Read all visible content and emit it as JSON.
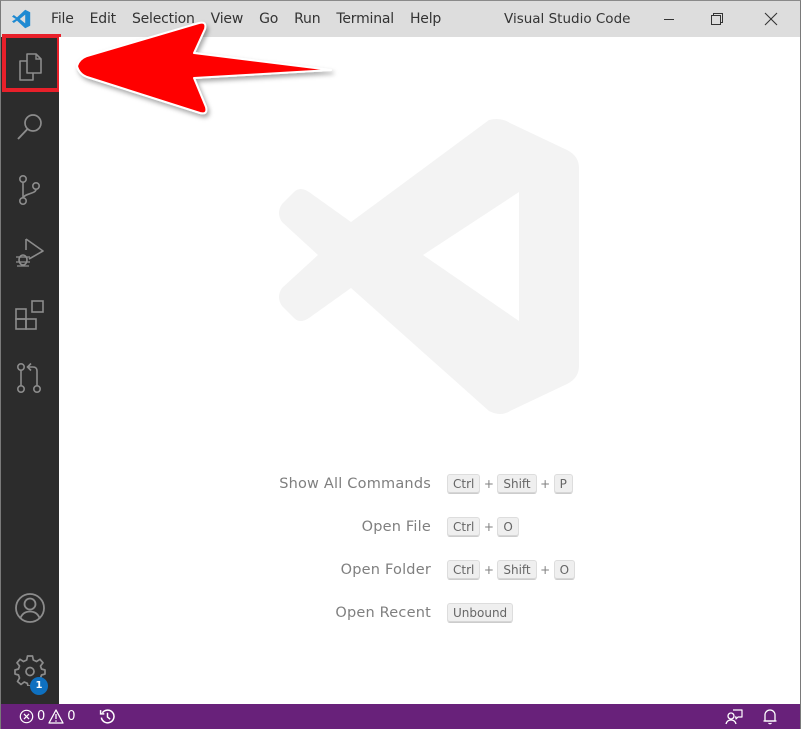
{
  "window": {
    "title": "Visual Studio Code",
    "app_icon": "vscode-logo-icon",
    "controls": [
      "minimize-icon",
      "restore-icon",
      "close-icon"
    ]
  },
  "menu": {
    "items": [
      "File",
      "Edit",
      "Selection",
      "View",
      "Go",
      "Run",
      "Terminal",
      "Help"
    ]
  },
  "activity_bar": {
    "items": [
      {
        "id": "explorer",
        "icon": "files-icon",
        "active": true
      },
      {
        "id": "search",
        "icon": "search-icon"
      },
      {
        "id": "source-control",
        "icon": "source-control-icon"
      },
      {
        "id": "run-debug",
        "icon": "run-debug-icon"
      },
      {
        "id": "extensions",
        "icon": "extensions-icon"
      },
      {
        "id": "pull-requests",
        "icon": "pull-request-icon"
      }
    ],
    "bottom": [
      {
        "id": "accounts",
        "icon": "account-icon"
      },
      {
        "id": "manage",
        "icon": "gear-icon",
        "badge": "1"
      }
    ]
  },
  "welcome": {
    "watermark_icon": "vscode-logo-watermark",
    "shortcuts": [
      {
        "label": "Show All Commands",
        "keys": [
          "Ctrl",
          "Shift",
          "P"
        ]
      },
      {
        "label": "Open File",
        "keys": [
          "Ctrl",
          "O"
        ]
      },
      {
        "label": "Open Folder",
        "keys": [
          "Ctrl",
          "Shift",
          "O"
        ]
      },
      {
        "label": "Open Recent",
        "keys": [
          "Unbound"
        ]
      }
    ],
    "separator": "+"
  },
  "status_bar": {
    "errors": "0",
    "warnings": "0",
    "history_icon": "history-icon",
    "feedback_icon": "feedback-icon",
    "notifications_icon": "bell-icon"
  },
  "annotation": {
    "arrow_color": "#ff0000",
    "highlight_color": "#e8202a",
    "points_to": "explorer"
  },
  "colors": {
    "titlebar": "#dddddd",
    "activity_bar": "#2c2c2c",
    "status_bar": "#68217a",
    "badge": "#0e70c0",
    "logo_blue": "#1f8ad2"
  }
}
